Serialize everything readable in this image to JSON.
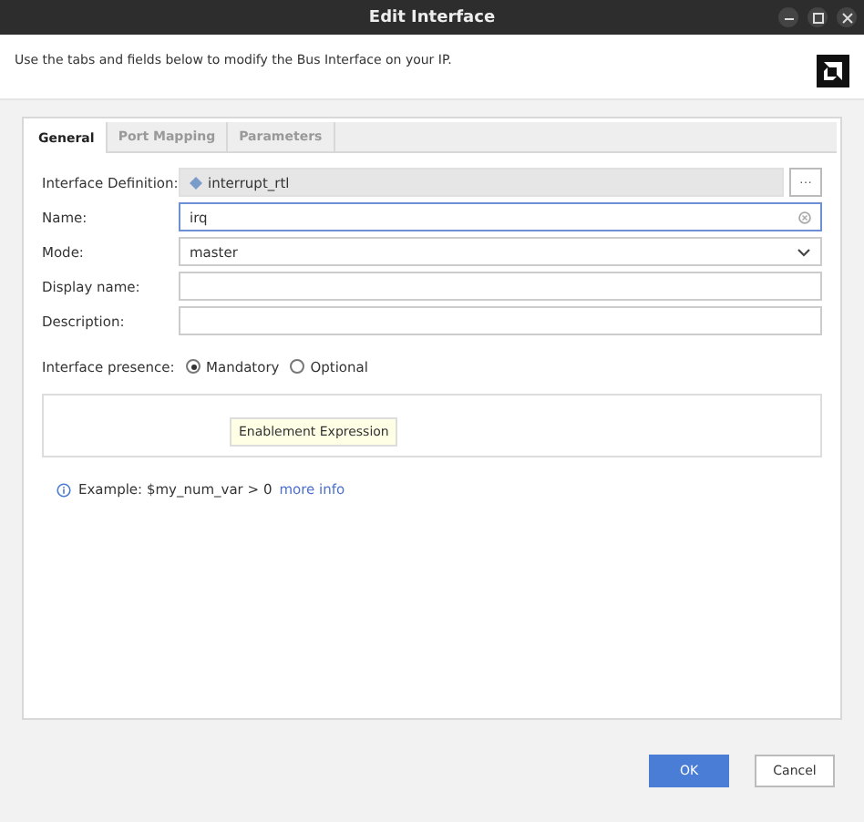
{
  "window": {
    "title": "Edit Interface"
  },
  "header": {
    "text": "Use the tabs and fields below to modify the Bus Interface on your IP."
  },
  "tabs": [
    {
      "label": "General",
      "selected": true
    },
    {
      "label": "Port Mapping",
      "selected": false
    },
    {
      "label": "Parameters",
      "selected": false
    }
  ],
  "form": {
    "interface_definition": {
      "label": "Interface Definition:",
      "value": "interrupt_rtl",
      "browse": "···"
    },
    "name": {
      "label": "Name:",
      "value": "irq"
    },
    "mode": {
      "label": "Mode:",
      "value": "master"
    },
    "display_name": {
      "label": "Display name:"
    },
    "description": {
      "label": "Description:"
    },
    "presence": {
      "label": "Interface presence:",
      "options": [
        {
          "label": "Mandatory",
          "selected": true
        },
        {
          "label": "Optional",
          "selected": false
        }
      ]
    },
    "tooltip": "Enablement Expression",
    "example": {
      "text": "Example:  $my_num_var > 0",
      "link": "more info"
    }
  },
  "buttons": [
    {
      "label": "OK",
      "kind": "primary"
    },
    {
      "label": "Cancel",
      "kind": "secondary"
    }
  ]
}
